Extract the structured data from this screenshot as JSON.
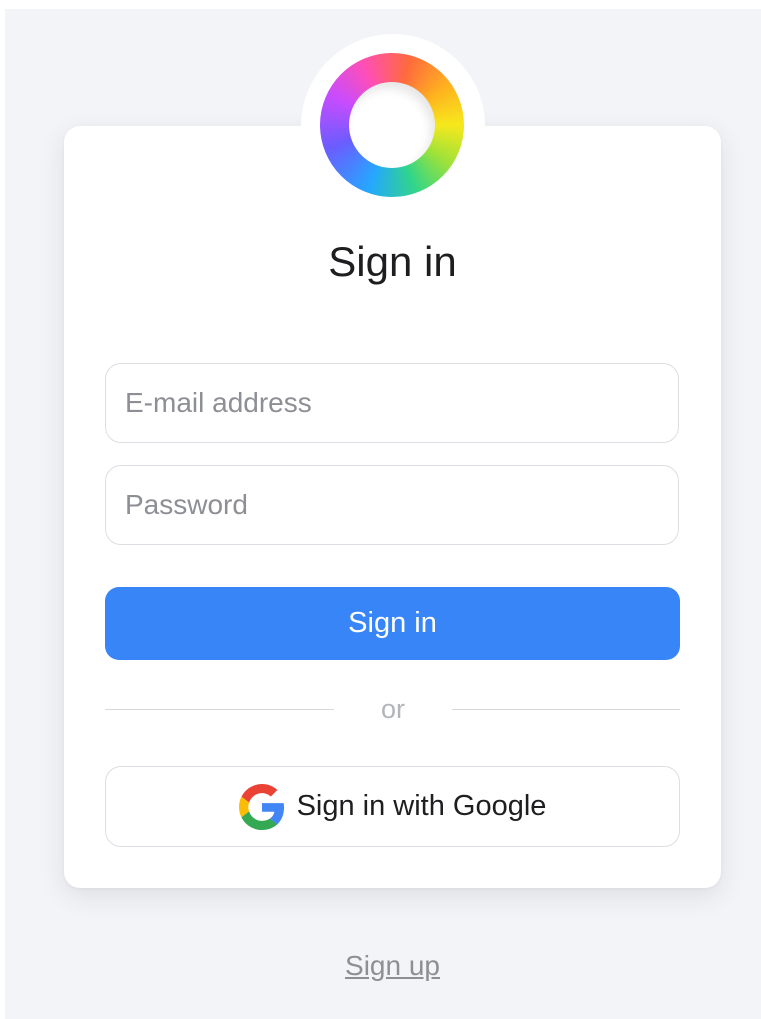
{
  "logo": {
    "icon": "rainbow-ring-logo"
  },
  "title": "Sign in",
  "form": {
    "email_placeholder": "E-mail address",
    "email_value": "",
    "password_placeholder": "Password",
    "password_value": "",
    "submit_label": "Sign in"
  },
  "divider": {
    "label": "or"
  },
  "google": {
    "label": "Sign in with Google",
    "icon": "google-g-icon"
  },
  "signup": {
    "label": "Sign up"
  },
  "colors": {
    "primary": "#3885f7",
    "background": "#f3f4f7",
    "card": "#ffffff",
    "text": "#1e1e20",
    "muted": "#8d8f95"
  }
}
